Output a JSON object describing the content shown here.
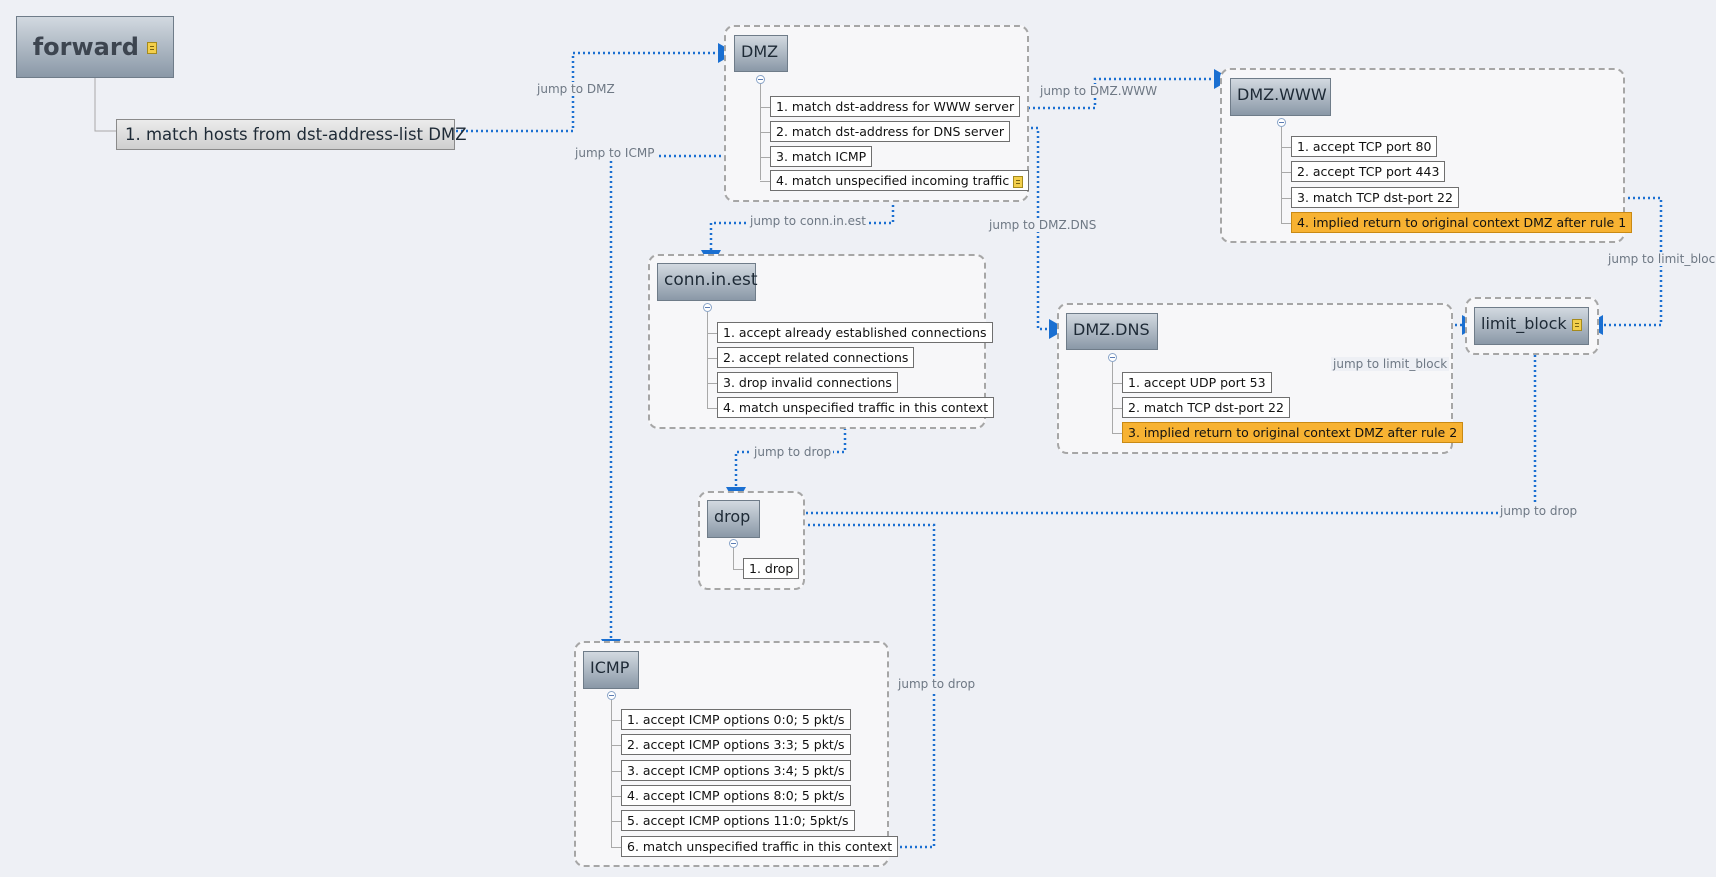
{
  "root": {
    "title": "forward",
    "rule": "1. match hosts from dst-address-list DMZ"
  },
  "dmz": {
    "title": "DMZ",
    "items": [
      "1. match dst-address for WWW server",
      "2. match dst-address for DNS server",
      "3. match ICMP",
      "4. match unspecified incoming traffic"
    ]
  },
  "dmzwww": {
    "title": "DMZ.WWW",
    "items": [
      "1. accept TCP port 80",
      "2. accept TCP port 443",
      "3. match TCP dst-port 22",
      "4. implied return to original context DMZ after rule 1"
    ]
  },
  "connin": {
    "title": "conn.in.est",
    "items": [
      "1. accept already established connections",
      "2. accept related connections",
      "3. drop invalid connections",
      "4. match unspecified traffic in this context"
    ]
  },
  "dmzdns": {
    "title": "DMZ.DNS",
    "items": [
      "1. accept UDP port 53",
      "2. match TCP dst-port 22",
      "3. implied return to original context DMZ after rule 2"
    ]
  },
  "limit": {
    "title": "limit_block"
  },
  "drop": {
    "title": "drop",
    "items": [
      "1. drop"
    ]
  },
  "icmp": {
    "title": "ICMP",
    "items": [
      "1. accept ICMP options 0:0; 5 pkt/s",
      "2. accept ICMP options 3:3; 5 pkt/s",
      "3. accept ICMP options 3:4; 5 pkt/s",
      "4. accept ICMP options 8:0; 5 pkt/s",
      "5. accept ICMP options 11:0; 5pkt/s",
      "6. match unspecified traffic in this context"
    ]
  },
  "edges": {
    "jump_dmz": "jump to DMZ",
    "jump_icmp": "jump to ICMP",
    "jump_dmzwww": "jump to DMZ.WWW",
    "jump_connin": "jump to conn.in.est",
    "jump_dmzdns": "jump to DMZ.DNS",
    "jump_limit_www": "jump to limit_block",
    "jump_limit_dns": "jump to limit_block",
    "jump_drop_conn": "jump to drop",
    "jump_drop_limit": "jump to drop",
    "jump_drop_icmp": "jump to drop"
  },
  "colors": {
    "edge": "#1a6fd1",
    "implied": "#f7b232"
  },
  "icons": {
    "note": "note-icon"
  }
}
